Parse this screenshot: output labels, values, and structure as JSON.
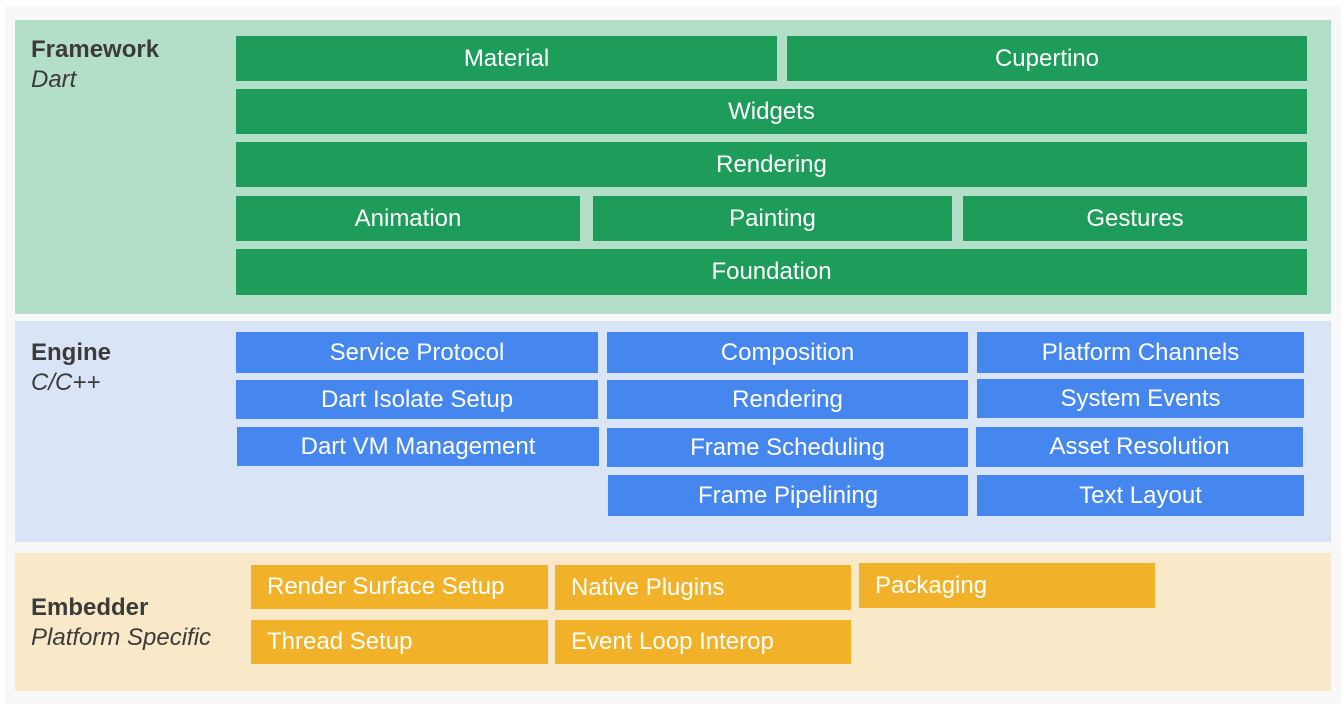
{
  "layers": {
    "framework": {
      "name": "Framework",
      "language": "Dart",
      "color": "#1e9c59",
      "background": "#b3dec8",
      "rows": [
        [
          "Material",
          "Cupertino"
        ],
        [
          "Widgets"
        ],
        [
          "Rendering"
        ],
        [
          "Animation",
          "Painting",
          "Gestures"
        ],
        [
          "Foundation"
        ]
      ]
    },
    "engine": {
      "name": "Engine",
      "language": "C/C++",
      "color": "#4687ef",
      "background": "#d9e5f7",
      "columns": [
        [
          "Service Protocol",
          "Dart Isolate Setup",
          "Dart VM Management"
        ],
        [
          "Composition",
          "Rendering",
          "Frame Scheduling",
          "Frame Pipelining"
        ],
        [
          "Platform Channels",
          "System Events",
          "Asset Resolution",
          "Text Layout"
        ]
      ]
    },
    "embedder": {
      "name": "Embedder",
      "language": "Platform Specific",
      "color": "#f1b22a",
      "background": "#f9e9c8",
      "rows": [
        [
          "Render Surface Setup",
          "Native Plugins",
          "Packaging"
        ],
        [
          "Thread Setup",
          "Event Loop Interop"
        ]
      ]
    }
  }
}
